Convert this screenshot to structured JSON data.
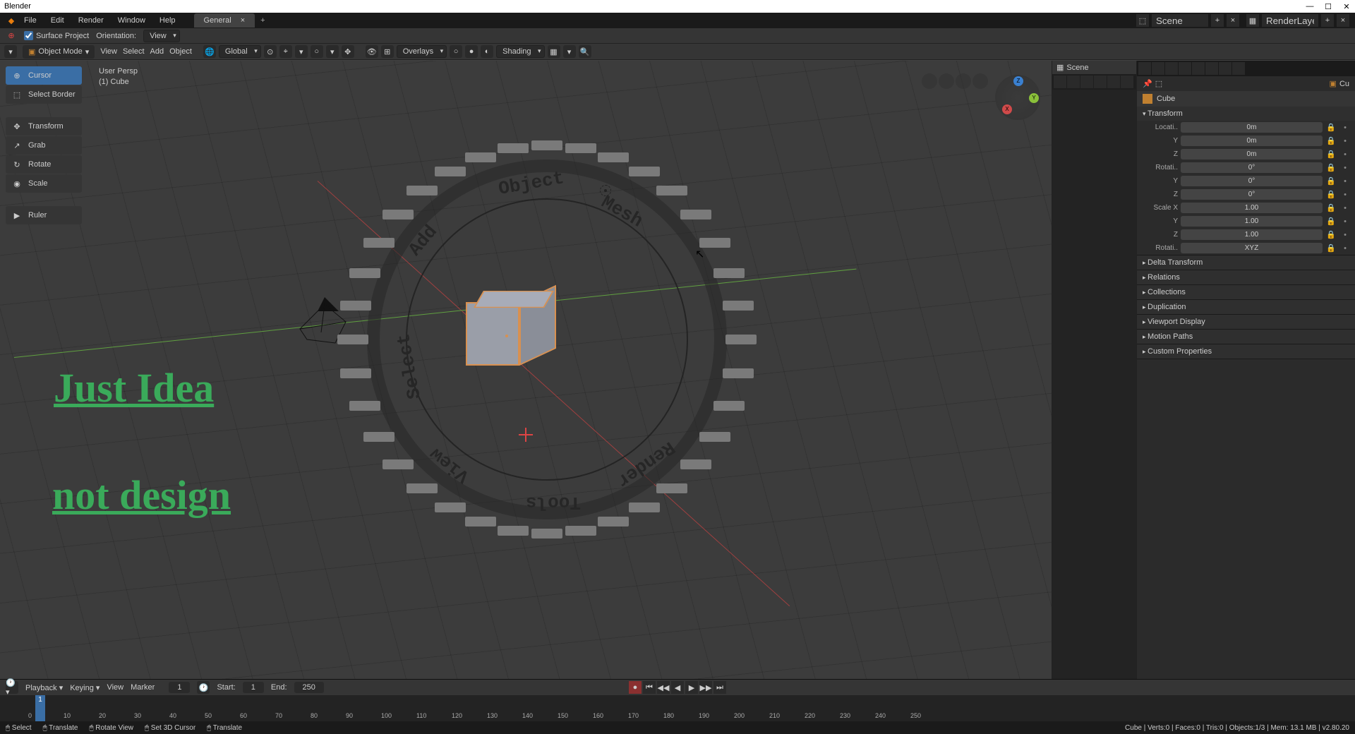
{
  "title": "Blender",
  "menubar": [
    "File",
    "Edit",
    "Render",
    "Window",
    "Help"
  ],
  "workspace_tab": "General",
  "scene_name": "Scene",
  "renderlayer": "RenderLayer",
  "topbar2": {
    "surface_project": "Surface Project",
    "orientation": "Orientation:",
    "orientation_val": "View"
  },
  "viewhdr": {
    "mode": "Object Mode",
    "menus": [
      "View",
      "Select",
      "Add",
      "Object"
    ],
    "orient": "Global",
    "overlays": "Overlays",
    "shading": "Shading"
  },
  "tools": [
    "Cursor",
    "Select Border",
    "Transform",
    "Grab",
    "Rotate",
    "Scale",
    "Ruler"
  ],
  "info": {
    "persp": "User Persp",
    "obj": "(1) Cube"
  },
  "pie_labels": [
    "Mesh",
    "Render",
    "Tools",
    "View",
    "Select",
    "Add",
    "Object"
  ],
  "annot1": "Just Idea",
  "annot2": "not design",
  "outliner": {
    "scene": "Scene",
    "item": "Cu"
  },
  "props": {
    "object": "Cube",
    "transform_label": "Transform",
    "rows": [
      {
        "lbl": "Locati..",
        "val": "0m"
      },
      {
        "lbl": "Y",
        "val": "0m"
      },
      {
        "lbl": "Z",
        "val": "0m"
      },
      {
        "lbl": "Rotati..",
        "val": "0°"
      },
      {
        "lbl": "Y",
        "val": "0°"
      },
      {
        "lbl": "Z",
        "val": "0°"
      },
      {
        "lbl": "Scale X",
        "val": "1.00"
      },
      {
        "lbl": "Y",
        "val": "1.00"
      },
      {
        "lbl": "Z",
        "val": "1.00"
      },
      {
        "lbl": "Rotati..",
        "val": "XYZ"
      }
    ],
    "sections": [
      "Delta Transform",
      "Relations",
      "Collections",
      "Duplication",
      "Viewport Display",
      "Motion Paths",
      "Custom Properties"
    ]
  },
  "timeline": {
    "menus": [
      "Playback",
      "Keying",
      "View",
      "Marker"
    ],
    "start_lbl": "Start:",
    "start": "1",
    "end_lbl": "End:",
    "end": "250",
    "current": "1",
    "ticks": [
      0,
      10,
      20,
      30,
      40,
      50,
      60,
      70,
      80,
      90,
      100,
      110,
      120,
      130,
      140,
      150,
      160,
      170,
      180,
      190,
      200,
      210,
      220,
      230,
      240,
      250
    ]
  },
  "status": {
    "left": [
      {
        "icon": "🖱",
        "t": "Select"
      },
      {
        "icon": "🖱",
        "t": "Translate"
      },
      {
        "icon": "🖱",
        "t": "Rotate View"
      },
      {
        "icon": "🖱",
        "t": "Set 3D Cursor"
      },
      {
        "icon": "🖱",
        "t": "Translate"
      }
    ],
    "right": "Cube | Verts:0 | Faces:0 | Tris:0 | Objects:1/3 | Mem: 13.1 MB | v2.80.20"
  }
}
